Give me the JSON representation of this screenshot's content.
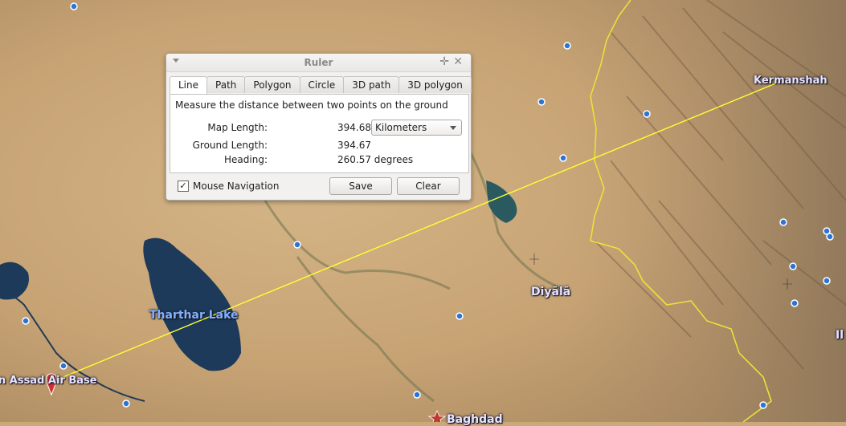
{
  "map": {
    "places": {
      "kermanshah": "Kermanshah",
      "tharthar": "Tharthar Lake",
      "diyala": "Diyālā",
      "assad": "n Assad Air Base",
      "baghdad": "Baghdad",
      "ilam_partial": "Il"
    }
  },
  "ruler": {
    "title": "Ruler",
    "tabs": [
      "Line",
      "Path",
      "Polygon",
      "Circle",
      "3D path",
      "3D polygon"
    ],
    "active_tab": "Line",
    "description": "Measure the distance between two points on the ground",
    "map_length_label": "Map Length:",
    "map_length_value": "394.68",
    "unit": "Kilometers",
    "ground_length_label": "Ground Length:",
    "ground_length_value": "394.67",
    "heading_label": "Heading:",
    "heading_value": "260.57 degrees",
    "mouse_nav_checked": "✓",
    "mouse_nav_label": "Mouse Navigation",
    "save_label": "Save",
    "clear_label": "Clear"
  },
  "colors": {
    "measure_line": "#ffff33",
    "border_line": "#e8e23a",
    "water": "#1e3a5a"
  }
}
